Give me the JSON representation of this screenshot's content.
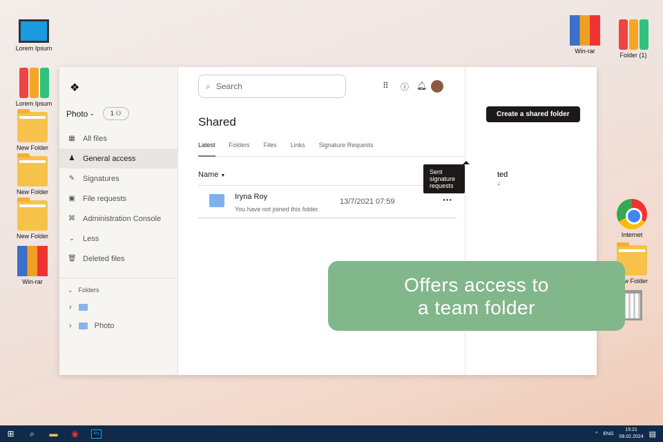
{
  "desktop": {
    "icons": [
      {
        "label": "Lorem Ipsum"
      },
      {
        "label": "Lorem Ipsum"
      },
      {
        "label": "New Folder"
      },
      {
        "label": "New Folder"
      },
      {
        "label": "New Folder"
      },
      {
        "label": "Win-rar"
      },
      {
        "label": "Win-rar"
      },
      {
        "label": "Folder (1)"
      },
      {
        "label": "Internet"
      },
      {
        "label": "New Folder"
      }
    ]
  },
  "sidebar": {
    "workspace": "Photo",
    "member_count": "1",
    "items": [
      {
        "label": "All files",
        "icon": "grid-icon"
      },
      {
        "label": "General access",
        "icon": "people-icon"
      },
      {
        "label": "Signatures",
        "icon": "signature-icon"
      },
      {
        "label": "File requests",
        "icon": "file-request-icon"
      },
      {
        "label": "Administration Console",
        "icon": "admin-icon"
      },
      {
        "label": "Less",
        "icon": "chevron-down-icon"
      },
      {
        "label": "Deleted files",
        "icon": "trash-icon"
      }
    ],
    "folders_heading": "Folders",
    "folders": [
      {
        "label": ""
      },
      {
        "label": "Photo"
      }
    ]
  },
  "header": {
    "search_placeholder": "Search"
  },
  "main": {
    "title": "Shared",
    "tabs": [
      "Latest",
      "Folders",
      "Files",
      "Links",
      "Signature Requests"
    ],
    "col_name": "Name",
    "col_date": "ted",
    "tooltip": "Sent signature requests",
    "rows": [
      {
        "name": "Iryna Roy",
        "sub": "You have not joined this folder.",
        "date": "13/7/2021 07:59"
      }
    ]
  },
  "right": {
    "create_label": "Create a shared folder"
  },
  "banner": {
    "line1": "Offers access to",
    "line2": "a team folder"
  },
  "taskbar": {
    "lang": "ENG",
    "time": "15:21",
    "date": "08.02.2024"
  },
  "colors": {
    "banner": "#82b68b",
    "taskbar": "#0f2a4a"
  }
}
